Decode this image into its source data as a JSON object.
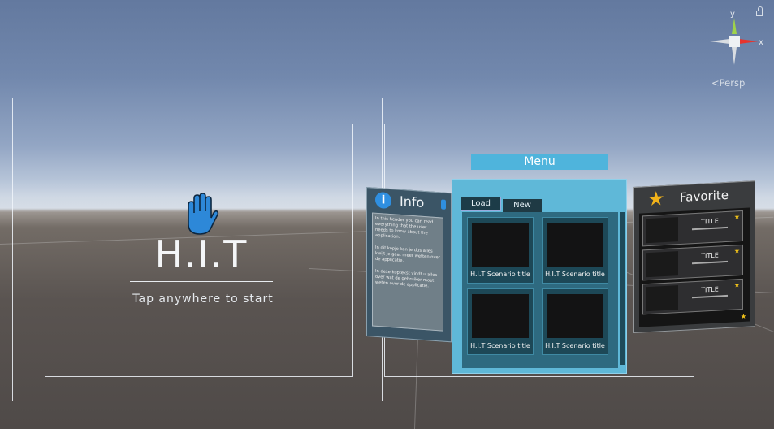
{
  "welcome": {
    "logo": "H.I.T",
    "prompt": "Tap anywhere to start",
    "hand_icon": "hand-icon"
  },
  "info": {
    "title": "Info",
    "paragraphs": [
      "In this header you can read everything that the user needs to know about the application.",
      "In dit kopje kan je dus alles kwijt je gaat meer wetten over de applicatie.",
      "In deze koptekst vindt u alles over wat de gebruiker moet weten over de applicatie."
    ]
  },
  "menu": {
    "title": "Menu",
    "tabs": [
      "Load",
      "New"
    ],
    "scenarios": [
      "H.I.T Scenario title",
      "H.I.T Scenario title",
      "H.I.T Scenario title",
      "H.I.T Scenario title"
    ]
  },
  "favorite": {
    "title": "Favorite",
    "items": [
      "TITLE",
      "TITLE",
      "TITLE"
    ]
  },
  "gizmo": {
    "y_label": "y",
    "x_label": "x",
    "view_label": "Persp"
  },
  "colors": {
    "menu_accent": "#4fb4dc",
    "info_icon": "#2f8fe0",
    "favorite_star": "#f2b31a"
  }
}
